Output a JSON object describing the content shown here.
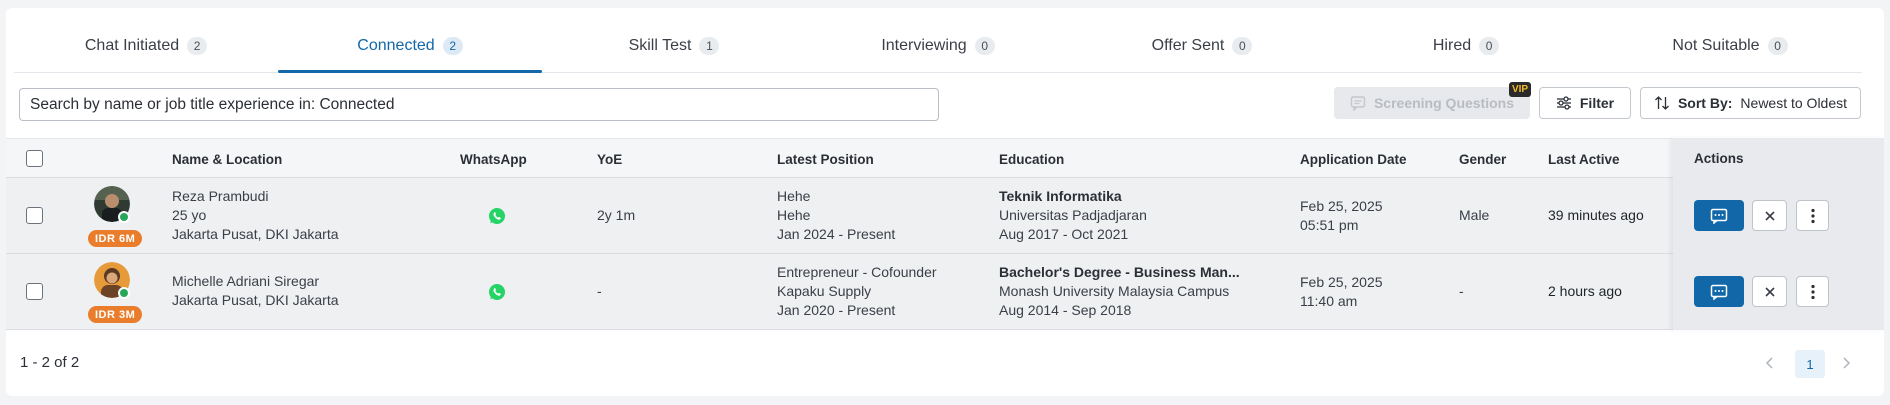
{
  "tabs": [
    {
      "label": "Chat Initiated",
      "count": "2"
    },
    {
      "label": "Connected",
      "count": "2"
    },
    {
      "label": "Skill Test",
      "count": "1"
    },
    {
      "label": "Interviewing",
      "count": "0"
    },
    {
      "label": "Offer Sent",
      "count": "0"
    },
    {
      "label": "Hired",
      "count": "0"
    },
    {
      "label": "Not Suitable",
      "count": "0"
    }
  ],
  "search": {
    "placeholder": "Search by name or job title experience in: Connected"
  },
  "toolbar": {
    "screening_label": "Screening Questions",
    "vip_badge": "VIP",
    "filter_label": "Filter",
    "sort_prefix": "Sort By:",
    "sort_value": "Newest to Oldest"
  },
  "table": {
    "headers": {
      "name": "Name & Location",
      "whatsapp": "WhatsApp",
      "yoe": "YoE",
      "position": "Latest Position",
      "education": "Education",
      "app_date": "Application Date",
      "gender": "Gender",
      "last_active": "Last Active",
      "actions": "Actions"
    },
    "rows": [
      {
        "salary": "IDR 6M",
        "name": "Reza Prambudi",
        "age": "25 yo",
        "location": "Jakarta Pusat, DKI Jakarta",
        "yoe": "2y 1m",
        "pos_title": "Hehe",
        "pos_company": "Hehe",
        "pos_period": "Jan 2024 - Present",
        "edu_degree": "Teknik Informatika",
        "edu_school": "Universitas Padjadjaran",
        "edu_period": "Aug 2017 - Oct 2021",
        "app_date": "Feb 25, 2025",
        "app_time": "05:51 pm",
        "gender": "Male",
        "last_active": "39 minutes ago"
      },
      {
        "salary": "IDR 3M",
        "name": "Michelle Adriani Siregar",
        "location": "Jakarta Pusat, DKI Jakarta",
        "yoe": "-",
        "pos_title": "Entrepreneur - Cofounder",
        "pos_company": "Kapaku Supply",
        "pos_period": "Jan 2020 - Present",
        "edu_degree": "Bachelor's Degree - Business Man...",
        "edu_school": "Monash University Malaysia Campus",
        "edu_period": "Aug 2014 - Sep 2018",
        "app_date": "Feb 25, 2025",
        "app_time": "11:40 am",
        "gender": "-",
        "last_active": "2 hours ago"
      }
    ]
  },
  "pagination": {
    "range": "1 - 2 of 2",
    "current_page": "1"
  },
  "colors": {
    "primary": "#1167a8",
    "salary_badge": "#ea7d2b",
    "online": "#25a85a",
    "whatsapp": "#25d366"
  }
}
